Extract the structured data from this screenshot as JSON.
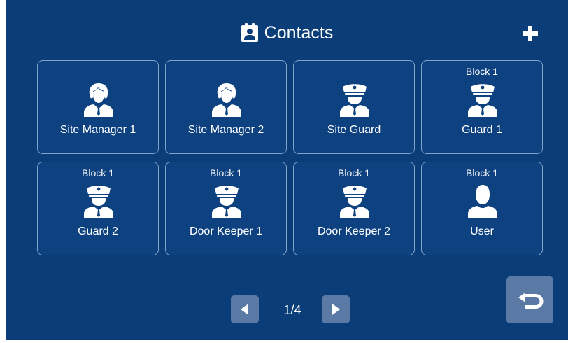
{
  "header": {
    "title": "Contacts",
    "title_icon": "contacts-book-icon",
    "add_icon": "plus-icon"
  },
  "contacts": [
    {
      "block": "",
      "name": "Site Manager 1",
      "icon": "female-manager-icon"
    },
    {
      "block": "",
      "name": "Site Manager 2",
      "icon": "female-manager-icon"
    },
    {
      "block": "",
      "name": "Site Guard",
      "icon": "guard-icon"
    },
    {
      "block": "Block 1",
      "name": "Guard 1",
      "icon": "guard-icon"
    },
    {
      "block": "Block 1",
      "name": "Guard 2",
      "icon": "guard-icon"
    },
    {
      "block": "Block 1",
      "name": "Door Keeper 1",
      "icon": "guard-icon"
    },
    {
      "block": "Block 1",
      "name": "Door Keeper 2",
      "icon": "guard-icon"
    },
    {
      "block": "Block 1",
      "name": "User",
      "icon": "user-icon"
    }
  ],
  "pager": {
    "indicator": "1/4",
    "prev_icon": "triangle-left-icon",
    "next_icon": "triangle-right-icon"
  },
  "back": {
    "icon": "return-arrow-icon"
  },
  "colors": {
    "background": "#0b3d78",
    "button": "#5a7aa5",
    "text": "#ffffff",
    "card_border": "#aac3e1"
  }
}
